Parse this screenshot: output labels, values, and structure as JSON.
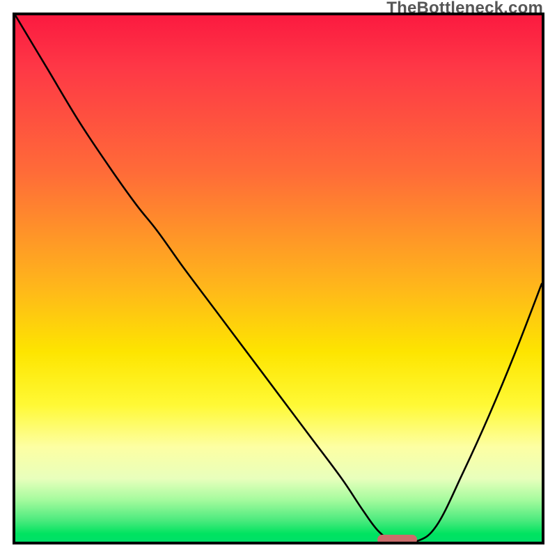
{
  "watermark": "TheBottleneck.com",
  "colors": {
    "border": "#000000",
    "marker": "#cb6c6b",
    "gradient_stops": [
      {
        "pct": 0,
        "hex": "#fb1a40"
      },
      {
        "pct": 10,
        "hex": "#fe3846"
      },
      {
        "pct": 30,
        "hex": "#ff6c38"
      },
      {
        "pct": 52,
        "hex": "#ffb81a"
      },
      {
        "pct": 64,
        "hex": "#fde500"
      },
      {
        "pct": 74,
        "hex": "#fff935"
      },
      {
        "pct": 82,
        "hex": "#fdffa3"
      },
      {
        "pct": 88,
        "hex": "#e8ffbc"
      },
      {
        "pct": 92,
        "hex": "#a6fb9e"
      },
      {
        "pct": 96,
        "hex": "#4aea7d"
      },
      {
        "pct": 98.5,
        "hex": "#00e360"
      },
      {
        "pct": 100,
        "hex": "#00e068"
      }
    ]
  },
  "chart_data": {
    "type": "line",
    "title": "",
    "xlabel": "",
    "ylabel": "",
    "xlim": [
      0,
      100
    ],
    "ylim": [
      0,
      100
    ],
    "x": [
      0,
      6,
      12,
      18,
      23,
      27,
      32,
      38,
      44,
      50,
      56,
      62,
      66,
      69,
      72,
      76,
      80,
      85,
      90,
      95,
      100
    ],
    "values": [
      100,
      90,
      80,
      71,
      64,
      59,
      52,
      44,
      36,
      28,
      20,
      12,
      6,
      2,
      0,
      0,
      3,
      13,
      24,
      36,
      49
    ],
    "marker": {
      "x_range": [
        69,
        76
      ],
      "value": 0
    }
  }
}
